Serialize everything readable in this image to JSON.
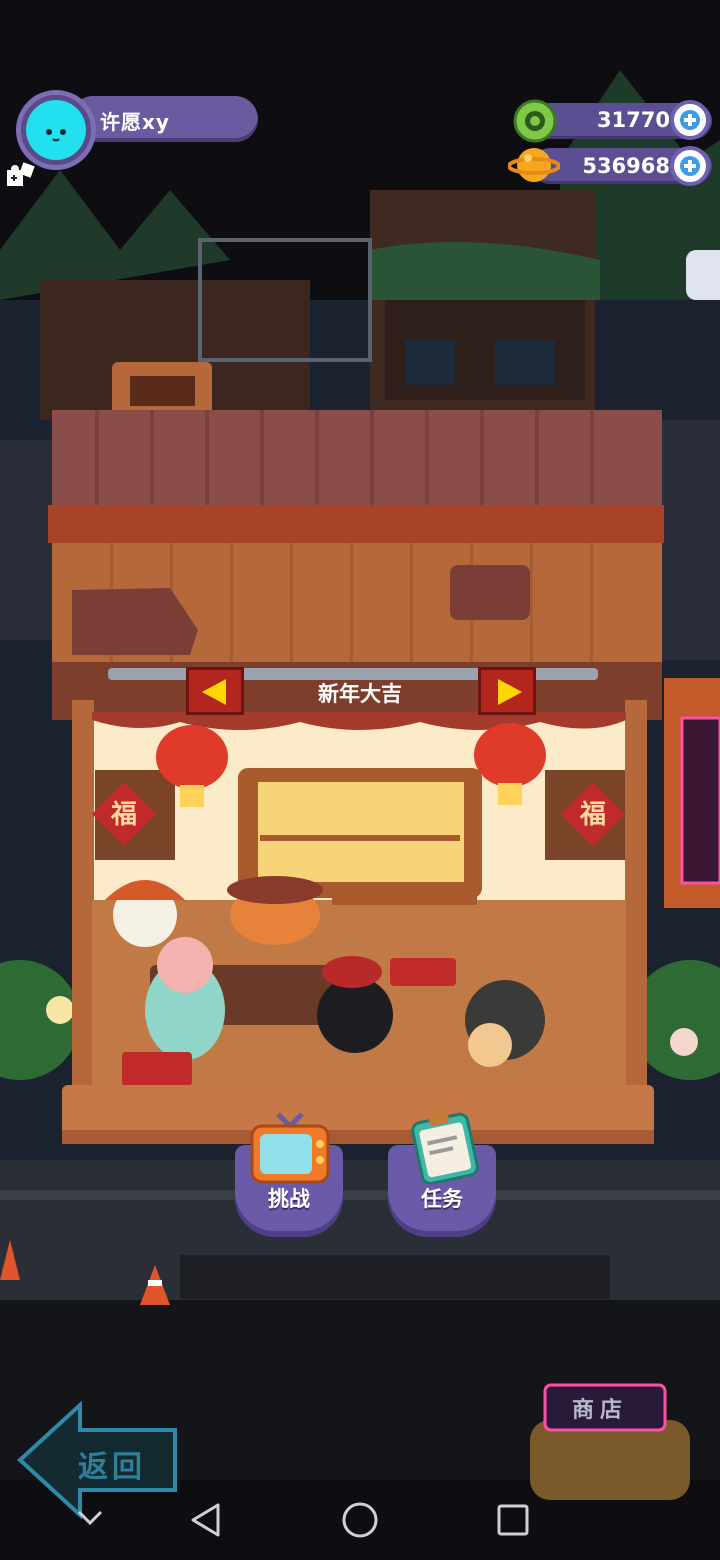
{
  "player": {
    "name": "许愿xy"
  },
  "currency": {
    "coins": "31770",
    "gems": "536968"
  },
  "shop": {
    "theme_name": "新年大吉",
    "sign_left": "福",
    "sign_right": "福"
  },
  "actions": {
    "challenge_label": "挑战",
    "tasks_label": "任务"
  },
  "navigation": {
    "back_label": "返回",
    "store_label": "商店"
  },
  "colors": {
    "profile_pill": "#6a5aa0",
    "avatar_cyan": "#22e0f0",
    "nav_button_red": "#b3261e",
    "arrow_yellow": "#ffd600",
    "roof": "#8a4d4a",
    "wood": "#b5693a"
  },
  "icons": {
    "avatar": "cat-avatar-icon",
    "puzzle": "puzzle-icon",
    "coin": "donut-coin-icon",
    "gem": "planet-gem-icon",
    "plus": "plus-icon",
    "challenge": "tv-icon",
    "tasks": "clipboard-icon",
    "back": "back-arrow-icon",
    "nav_back": "triangle-back-icon",
    "nav_home": "circle-home-icon",
    "nav_recent": "square-recent-icon",
    "nav_collapse": "chevron-down-icon"
  }
}
